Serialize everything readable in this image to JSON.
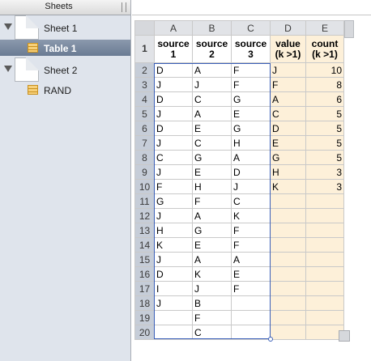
{
  "sidebar": {
    "title": "Sheets",
    "sheets": [
      {
        "label": "Sheet 1",
        "tables": [
          {
            "label": "Table 1",
            "selected": true
          }
        ]
      },
      {
        "label": "Sheet 2",
        "tables": [
          {
            "label": "RAND",
            "selected": false
          }
        ]
      }
    ]
  },
  "grid": {
    "columns": [
      "A",
      "B",
      "C",
      "D",
      "E"
    ],
    "headers": [
      [
        "source",
        "1"
      ],
      [
        "source",
        "2"
      ],
      [
        "source",
        "3"
      ],
      [
        "value",
        "(k >1)"
      ],
      [
        "count",
        "(k >1)"
      ]
    ],
    "rows": [
      {
        "n": "2",
        "cells": [
          "D",
          "A",
          "F",
          "J",
          "10"
        ]
      },
      {
        "n": "3",
        "cells": [
          "J",
          "J",
          "F",
          "F",
          "8"
        ]
      },
      {
        "n": "4",
        "cells": [
          "D",
          "C",
          "G",
          "A",
          "6"
        ]
      },
      {
        "n": "5",
        "cells": [
          "J",
          "A",
          "E",
          "C",
          "5"
        ]
      },
      {
        "n": "6",
        "cells": [
          "D",
          "E",
          "G",
          "D",
          "5"
        ]
      },
      {
        "n": "7",
        "cells": [
          "J",
          "C",
          "H",
          "E",
          "5"
        ]
      },
      {
        "n": "8",
        "cells": [
          "C",
          "G",
          "A",
          "G",
          "5"
        ]
      },
      {
        "n": "9",
        "cells": [
          "J",
          "E",
          "D",
          "H",
          "3"
        ]
      },
      {
        "n": "10",
        "cells": [
          "F",
          "H",
          "J",
          "K",
          "3"
        ]
      },
      {
        "n": "11",
        "cells": [
          "G",
          "F",
          "C",
          "",
          ""
        ]
      },
      {
        "n": "12",
        "cells": [
          "J",
          "A",
          "K",
          "",
          ""
        ]
      },
      {
        "n": "13",
        "cells": [
          "H",
          "G",
          "F",
          "",
          ""
        ]
      },
      {
        "n": "14",
        "cells": [
          "K",
          "E",
          "F",
          "",
          ""
        ]
      },
      {
        "n": "15",
        "cells": [
          "J",
          "A",
          "A",
          "",
          ""
        ]
      },
      {
        "n": "16",
        "cells": [
          "D",
          "K",
          "E",
          "",
          ""
        ]
      },
      {
        "n": "17",
        "cells": [
          "I",
          "J",
          "F",
          "",
          ""
        ]
      },
      {
        "n": "18",
        "cells": [
          "J",
          "B",
          "",
          "",
          ""
        ]
      },
      {
        "n": "19",
        "cells": [
          "",
          "F",
          "",
          "",
          ""
        ]
      },
      {
        "n": "20",
        "cells": [
          "",
          "C",
          "",
          "",
          ""
        ]
      }
    ]
  },
  "colors": {
    "selection": "#3a5fb8",
    "value_fill": "#fdf0d9",
    "sidebar_selected": "#6a7b93"
  }
}
